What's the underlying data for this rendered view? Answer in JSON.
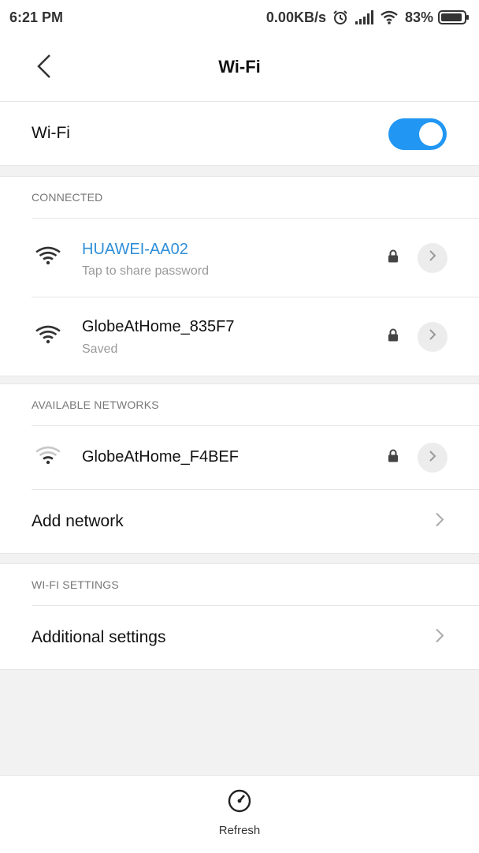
{
  "status_bar": {
    "time": "6:21 PM",
    "speed": "0.00KB/s",
    "battery": "83%",
    "icons": [
      "alarm-icon",
      "signal-icon",
      "wifi-icon",
      "battery-icon"
    ]
  },
  "header": {
    "title": "Wi-Fi",
    "back_icon": "chevron-left-icon"
  },
  "wifi_toggle": {
    "label": "Wi-Fi",
    "state": "on",
    "color": "#2196f3"
  },
  "connected": {
    "header": "CONNECTED",
    "networks": [
      {
        "name": "HUAWEI-AA02",
        "subtitle": "Tap to share password",
        "secured": true,
        "active": true
      },
      {
        "name": "GlobeAtHome_835F7",
        "subtitle": "Saved",
        "secured": true,
        "active": false
      }
    ]
  },
  "available": {
    "header": "AVAILABLE NETWORKS",
    "networks": [
      {
        "name": "GlobeAtHome_F4BEF",
        "secured": true
      }
    ],
    "add_network_label": "Add network"
  },
  "wifi_settings": {
    "header": "WI-FI SETTINGS",
    "additional_label": "Additional settings"
  },
  "bottom": {
    "refresh_label": "Refresh"
  },
  "colors": {
    "accent": "#2196f3",
    "active_network": "#2f8fd8"
  }
}
